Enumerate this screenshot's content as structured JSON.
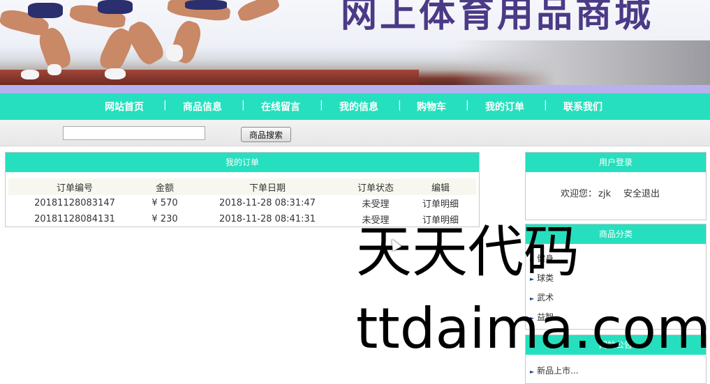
{
  "banner": {
    "site_title": "网上体育用品商城"
  },
  "nav": {
    "items": [
      "网站首页",
      "商品信息",
      "在线留言",
      "我的信息",
      "购物车",
      "我的订单",
      "联系我们"
    ],
    "separator": "|"
  },
  "search": {
    "value": "",
    "button_label": "商品搜索"
  },
  "orders": {
    "title": "我的订单",
    "columns": [
      "订单编号",
      "金额",
      "下单日期",
      "订单状态",
      "编辑"
    ],
    "rows": [
      {
        "id": "20181128083147",
        "amount": "¥ 570",
        "date": "2018-11-28 08:31:47",
        "status": "未受理",
        "action": "订单明细"
      },
      {
        "id": "20181128084131",
        "amount": "¥ 230",
        "date": "2018-11-28 08:41:31",
        "status": "未受理",
        "action": "订单明细"
      }
    ]
  },
  "login": {
    "title": "用户登录",
    "welcome": "欢迎您：",
    "username": "zjk",
    "logout": "安全退出"
  },
  "categories": {
    "title": "商品分类",
    "items": [
      "健身",
      "球类",
      "武术",
      "益智"
    ]
  },
  "news": {
    "title": "网站公告",
    "items": [
      "新品上市..."
    ]
  },
  "watermark": {
    "line1": "天天代码",
    "line2": "ttdaima.com"
  },
  "colors": {
    "accent": "#26dfbe",
    "strip": "#b7b2ee",
    "title": "#4b3a86"
  }
}
